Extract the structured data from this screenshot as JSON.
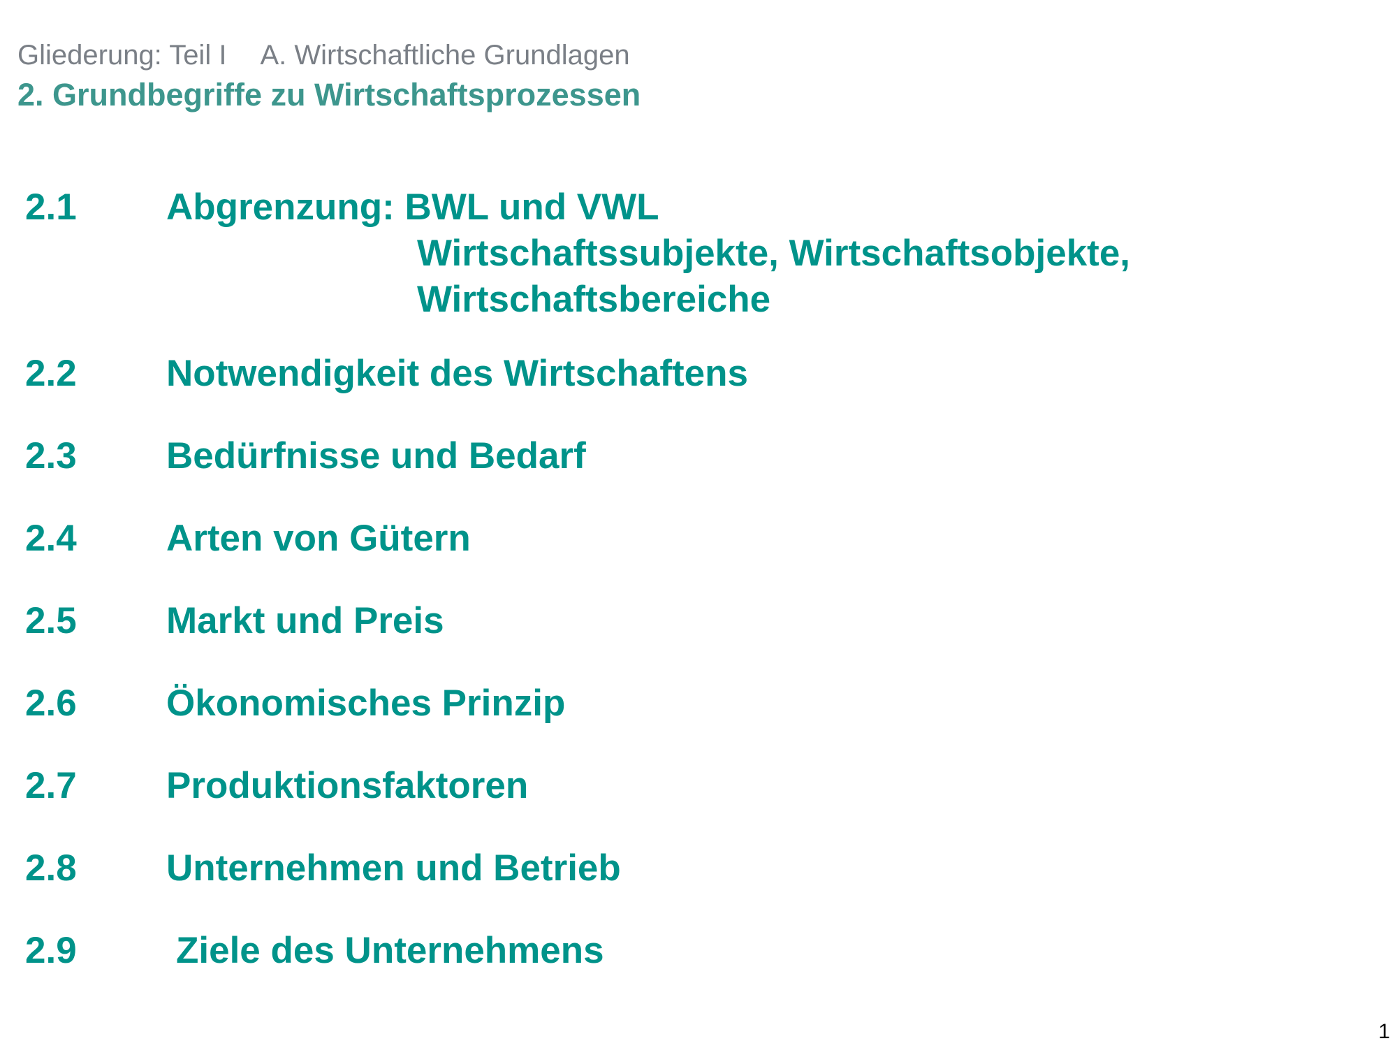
{
  "header": {
    "outline_label": "Gliederung: Teil I",
    "part_title": "A. Wirtschaftliche Grundlagen",
    "chapter_title": "2. Grundbegriffe zu Wirtschaftsprozessen"
  },
  "toc": [
    {
      "number": "2.1",
      "title": "Abgrenzung: BWL und VWL",
      "sub_lines": [
        "Wirtschaftssubjekte, Wirtschaftsobjekte,",
        "Wirtschaftsbereiche"
      ]
    },
    {
      "number": "2.2",
      "title": "Notwendigkeit des Wirtschaftens"
    },
    {
      "number": "2.3",
      "title": "Bedürfnisse und Bedarf"
    },
    {
      "number": "2.4",
      "title": "Arten von Gütern"
    },
    {
      "number": "2.5",
      "title": "Markt und Preis"
    },
    {
      "number": "2.6",
      "title": "Ökonomisches Prinzip"
    },
    {
      "number": "2.7",
      "title": "Produktionsfaktoren"
    },
    {
      "number": "2.8",
      "title": "Unternehmen und Betrieb"
    },
    {
      "number": "2.9",
      "title": "Ziele des Unternehmens"
    }
  ],
  "page_number": "1",
  "colors": {
    "header_gray": "#7a7f86",
    "chapter_teal": "#3d968d",
    "toc_teal": "#00938a"
  }
}
